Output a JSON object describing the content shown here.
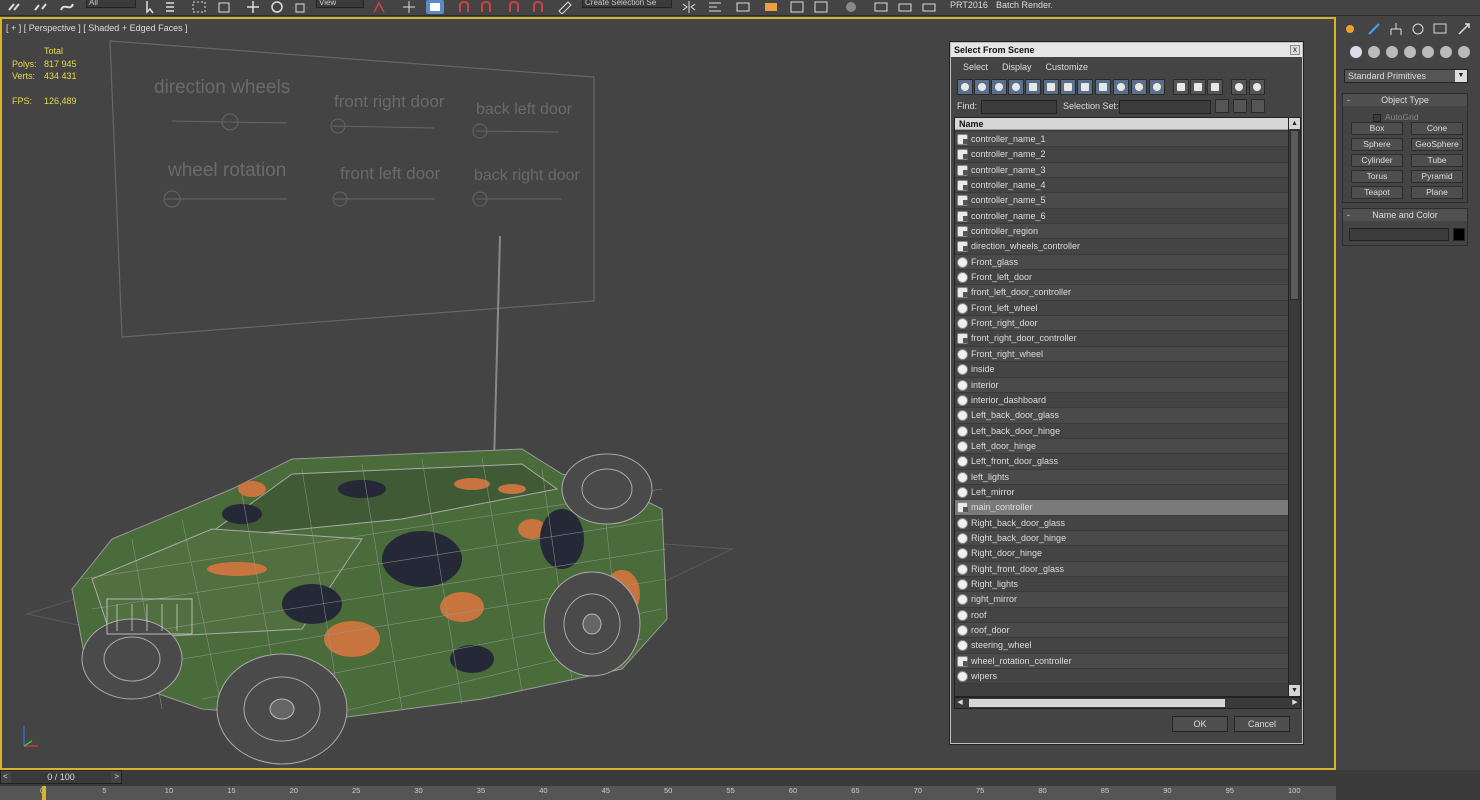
{
  "toolbar": {
    "filter_value": "All",
    "view_value": "View",
    "selection_set_placeholder": "Create Selection Se",
    "prt_label": "PRT2016",
    "batch_render_label": "Batch Render..."
  },
  "viewport": {
    "label": "[ + ] [ Perspective ] [ Shaded + Edged Faces ]",
    "stats": {
      "header": "Total",
      "polys_label": "Polys:",
      "polys_value": "817 945",
      "verts_label": "Verts:",
      "verts_value": "434 431",
      "fps_label": "FPS:",
      "fps_value": "126,489"
    },
    "panel_labels": {
      "direction_wheels": "direction wheels",
      "front_right_door": "front right door",
      "back_left_door": "back left door",
      "wheel_rotation": "wheel rotation",
      "front_left_door": "front left door",
      "back_right_door": "back right door"
    }
  },
  "dialog": {
    "title": "Select From Scene",
    "close_glyph": "x",
    "menu": [
      "Select",
      "Display",
      "Customize"
    ],
    "find_label": "Find:",
    "find_value": "",
    "selection_set_label": "Selection Set:",
    "selection_set_value": "",
    "column_header": "Name",
    "ok_label": "OK",
    "cancel_label": "Cancel",
    "items": [
      {
        "name": "controller_name_1",
        "icon": "controller-icon"
      },
      {
        "name": "controller_name_2",
        "icon": "controller-icon"
      },
      {
        "name": "controller_name_3",
        "icon": "controller-icon"
      },
      {
        "name": "controller_name_4",
        "icon": "controller-icon"
      },
      {
        "name": "controller_name_5",
        "icon": "controller-icon"
      },
      {
        "name": "controller_name_6",
        "icon": "controller-icon"
      },
      {
        "name": "controller_region",
        "icon": "controller-icon"
      },
      {
        "name": "direction_wheels_controller",
        "icon": "controller-icon"
      },
      {
        "name": "Front_glass",
        "icon": "geometry-icon"
      },
      {
        "name": "Front_left_door",
        "icon": "geometry-icon"
      },
      {
        "name": "front_left_door_controller",
        "icon": "controller-icon"
      },
      {
        "name": "Front_left_wheel",
        "icon": "geometry-icon"
      },
      {
        "name": "Front_right_door",
        "icon": "geometry-icon"
      },
      {
        "name": "front_right_door_controller",
        "icon": "controller-icon"
      },
      {
        "name": "Front_right_wheel",
        "icon": "geometry-icon"
      },
      {
        "name": "inside",
        "icon": "geometry-icon"
      },
      {
        "name": "interior",
        "icon": "geometry-icon"
      },
      {
        "name": "interior_dashboard",
        "icon": "geometry-icon"
      },
      {
        "name": "Left_back_door_glass",
        "icon": "geometry-icon"
      },
      {
        "name": "Left_back_door_hinge",
        "icon": "geometry-icon"
      },
      {
        "name": "Left_door_hinge",
        "icon": "geometry-icon"
      },
      {
        "name": "Left_front_door_glass",
        "icon": "geometry-icon"
      },
      {
        "name": "left_lights",
        "icon": "geometry-icon"
      },
      {
        "name": "Left_mirror",
        "icon": "geometry-icon"
      },
      {
        "name": "main_controller",
        "icon": "controller-icon",
        "selected": true
      },
      {
        "name": "Right_back_door_glass",
        "icon": "geometry-icon"
      },
      {
        "name": "Right_back_door_hinge",
        "icon": "geometry-icon"
      },
      {
        "name": "Right_door_hinge",
        "icon": "geometry-icon"
      },
      {
        "name": "Right_front_door_glass",
        "icon": "geometry-icon"
      },
      {
        "name": "Right_lights",
        "icon": "geometry-icon"
      },
      {
        "name": "right_mirror",
        "icon": "geometry-icon"
      },
      {
        "name": "roof",
        "icon": "geometry-icon"
      },
      {
        "name": "roof_door",
        "icon": "geometry-icon"
      },
      {
        "name": "steering_wheel",
        "icon": "geometry-icon"
      },
      {
        "name": "wheel_rotation_controller",
        "icon": "controller-icon"
      },
      {
        "name": "wipers",
        "icon": "geometry-icon"
      }
    ]
  },
  "command_panel": {
    "category_dropdown": "Standard Primitives",
    "object_type_title": "Object Type",
    "autogrid_label": "AutoGrid",
    "buttons": [
      "Box",
      "Cone",
      "Sphere",
      "GeoSphere",
      "Cylinder",
      "Tube",
      "Torus",
      "Pyramid",
      "Teapot",
      "Plane"
    ],
    "name_color_title": "Name and Color",
    "name_value": "",
    "color_swatch": "#000000"
  },
  "timeline": {
    "frame_display": "0 / 100",
    "ticks": [
      "0",
      "5",
      "10",
      "15",
      "20",
      "25",
      "30",
      "35",
      "40",
      "45",
      "50",
      "55",
      "60",
      "65",
      "70",
      "75",
      "80",
      "85",
      "90",
      "95",
      "100"
    ]
  },
  "colors": {
    "active_viewport_border": "#d8b42a",
    "stats_text": "#e8d84a",
    "camo_green": "#4a6b3a",
    "camo_orange": "#c8743e",
    "camo_dark": "#252837"
  }
}
